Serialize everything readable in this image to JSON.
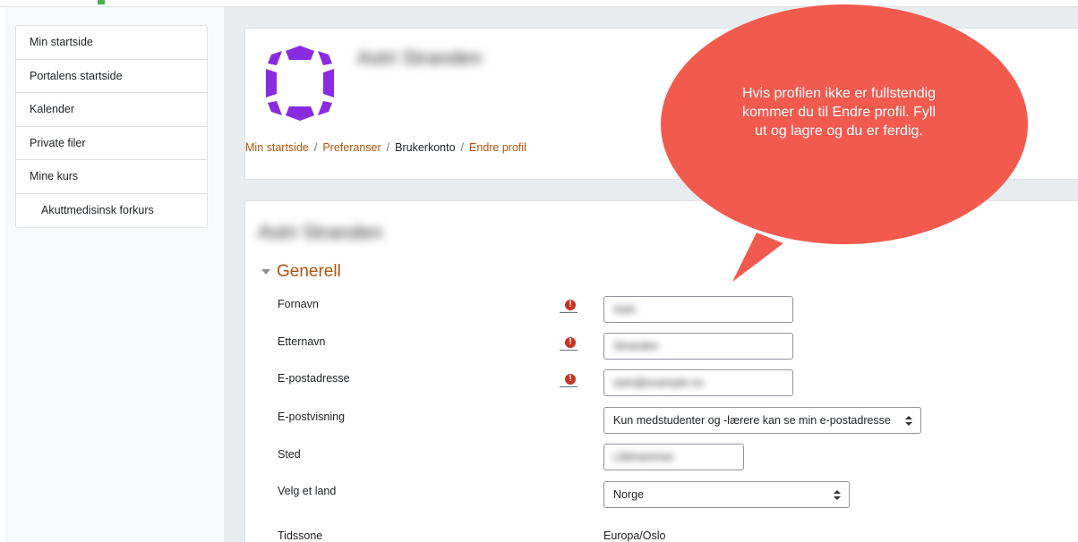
{
  "sidebar": {
    "items": [
      {
        "label": "Min startside"
      },
      {
        "label": "Portalens startside"
      },
      {
        "label": "Kalender"
      },
      {
        "label": "Private filer"
      },
      {
        "label": "Mine kurs"
      },
      {
        "label": "Akuttmedisinsk forkurs"
      }
    ]
  },
  "profile": {
    "name": "Astri Stranden"
  },
  "breadcrumb": {
    "items": [
      {
        "label": "Min startside"
      },
      {
        "label": "Preferanser"
      },
      {
        "label": "Brukerkonto"
      },
      {
        "label": "Endre profil"
      }
    ],
    "separator": "/"
  },
  "form": {
    "title": "Astri Stranden",
    "section_title": "Generell",
    "required_icon": "exclamation-icon",
    "fields": {
      "firstname": {
        "label": "Fornavn",
        "value": "Astri"
      },
      "lastname": {
        "label": "Etternavn",
        "value": "Stranden"
      },
      "email": {
        "label": "E-postadresse",
        "value": "astri@example.no"
      },
      "maildisplay": {
        "label": "E-postvisning",
        "value": "Kun medstudenter og -lærere kan se min e-postadresse"
      },
      "city": {
        "label": "Sted",
        "value": "Lillehammer"
      },
      "country": {
        "label": "Velg et land",
        "value": "Norge"
      },
      "timezone": {
        "label": "Tidssone",
        "value": "Europa/Oslo"
      }
    }
  },
  "callout": {
    "text": "Hvis profilen ikke er fullstendig kommer du til Endre profil. Fyll ut og lagre og du er ferdig.",
    "color": "#f25a4e"
  },
  "colors": {
    "accent": "#b15310",
    "required": "#ca3120",
    "avatar": "#8a2be2"
  }
}
